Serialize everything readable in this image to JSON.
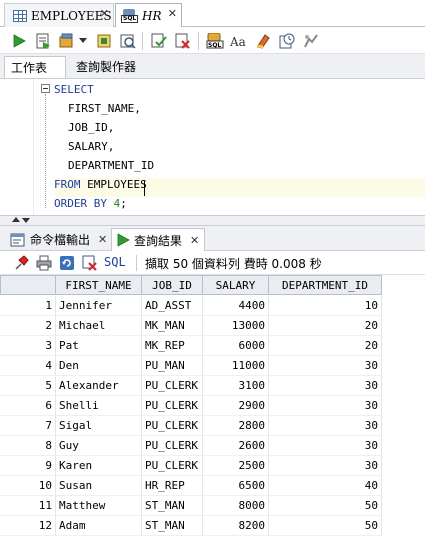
{
  "doc_tabs": [
    {
      "label": "EMPLOYEES",
      "icon": "table-grid-icon",
      "active": false
    },
    {
      "label": "HR",
      "icon": "sql-worksheet-icon",
      "active": true
    }
  ],
  "toolbar": {
    "icons": [
      "run-statement-icon",
      "run-script-icon",
      "commit-icon",
      "dropdown-arrow-icon",
      "explain-plan-icon",
      "autotrace-icon",
      "commit-transaction-icon",
      "rollback-icon",
      "sql-tuning-icon",
      "to-upper-lower-icon",
      "clear-icon",
      "sql-history-icon",
      "unshared-sql-icon"
    ]
  },
  "sub_tabs": {
    "worksheet": "工作表",
    "query_builder": "查詢製作器"
  },
  "editor": {
    "line1_kw": "SELECT",
    "line2": "FIRST_NAME,",
    "line3": "JOB_ID,",
    "line4": "SALARY,",
    "line5": "DEPARTMENT_ID",
    "line6_kw": "FROM",
    "line6_rest": " EMPLOYEES",
    "line7_kw": "ORDER BY",
    "line7_num": "4",
    "line7_end": ";"
  },
  "output_tabs": {
    "script_output": "命令檔輸出",
    "query_result": "查詢結果"
  },
  "result_toolbar": {
    "sql_label": "SQL",
    "status": "擷取 50 個資料列 費時 0.008 秒"
  },
  "grid": {
    "columns": [
      "FIRST_NAME",
      "JOB_ID",
      "SALARY",
      "DEPARTMENT_ID"
    ],
    "rows": [
      {
        "n": "1",
        "first_name": "Jennifer",
        "job_id": "AD_ASST",
        "salary": "4400",
        "dept": "10"
      },
      {
        "n": "2",
        "first_name": "Michael",
        "job_id": "MK_MAN",
        "salary": "13000",
        "dept": "20"
      },
      {
        "n": "3",
        "first_name": "Pat",
        "job_id": "MK_REP",
        "salary": "6000",
        "dept": "20"
      },
      {
        "n": "4",
        "first_name": "Den",
        "job_id": "PU_MAN",
        "salary": "11000",
        "dept": "30"
      },
      {
        "n": "5",
        "first_name": "Alexander",
        "job_id": "PU_CLERK",
        "salary": "3100",
        "dept": "30"
      },
      {
        "n": "6",
        "first_name": "Shelli",
        "job_id": "PU_CLERK",
        "salary": "2900",
        "dept": "30"
      },
      {
        "n": "7",
        "first_name": "Sigal",
        "job_id": "PU_CLERK",
        "salary": "2800",
        "dept": "30"
      },
      {
        "n": "8",
        "first_name": "Guy",
        "job_id": "PU_CLERK",
        "salary": "2600",
        "dept": "30"
      },
      {
        "n": "9",
        "first_name": "Karen",
        "job_id": "PU_CLERK",
        "salary": "2500",
        "dept": "30"
      },
      {
        "n": "10",
        "first_name": "Susan",
        "job_id": "HR_REP",
        "salary": "6500",
        "dept": "40"
      },
      {
        "n": "11",
        "first_name": "Matthew",
        "job_id": "ST_MAN",
        "salary": "8000",
        "dept": "50"
      },
      {
        "n": "12",
        "first_name": "Adam",
        "job_id": "ST_MAN",
        "salary": "8200",
        "dept": "50"
      }
    ]
  }
}
